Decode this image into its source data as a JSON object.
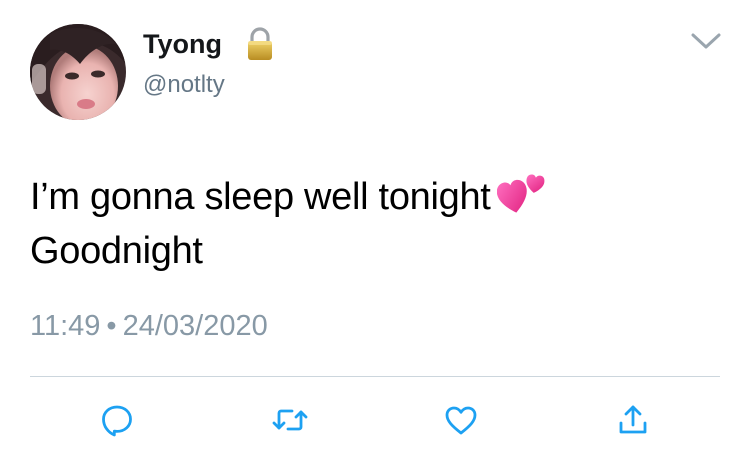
{
  "tweet": {
    "author": {
      "display_name": "Tyong",
      "handle": "@notlty",
      "protected_icon": "lock-icon"
    },
    "text_lines": [
      "I’m gonna sleep well tonight",
      "Goodnight"
    ],
    "emoji": "two-hearts-emoji",
    "time": "11:49",
    "separator": "•",
    "date": "24/03/2020"
  },
  "actions": [
    {
      "name": "reply",
      "icon": "reply-icon"
    },
    {
      "name": "retweet",
      "icon": "retweet-icon"
    },
    {
      "name": "like",
      "icon": "heart-icon"
    },
    {
      "name": "share",
      "icon": "share-icon"
    }
  ],
  "menu_icon": "chevron-down-icon",
  "colors": {
    "text": "#000000",
    "secondary": "#657786",
    "timestamp": "#8899a6",
    "icon": "#1da1f2",
    "divider": "#ccd6dd",
    "lock": "#c9a23a",
    "emoji_pink": "#ff3d9a"
  }
}
